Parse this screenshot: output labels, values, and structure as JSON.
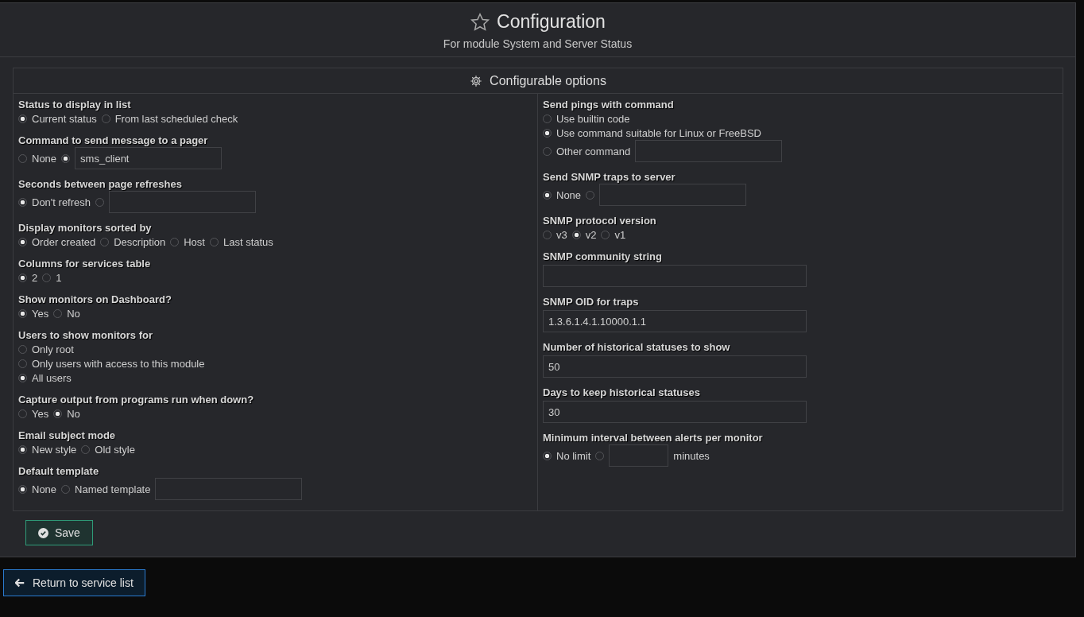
{
  "header": {
    "title": "Configuration",
    "subtitle": "For module System and Server Status"
  },
  "section": {
    "title": "Configurable options"
  },
  "columns": [
    {
      "options": [
        {
          "label": "Status to display in list",
          "kind": "radio_row",
          "choices": [
            {
              "kind": "radio",
              "label": "Current status",
              "selected": true
            },
            {
              "kind": "radio",
              "label": "From last scheduled check",
              "selected": false
            }
          ]
        },
        {
          "label": "Command to send message to a pager",
          "kind": "radio_row",
          "choices": [
            {
              "kind": "radio",
              "label": "None",
              "selected": false
            },
            {
              "kind": "radio",
              "selected": true
            },
            {
              "kind": "field",
              "value": "sms_client"
            }
          ]
        },
        {
          "label": "Seconds between page refreshes",
          "kind": "radio_row",
          "choices": [
            {
              "kind": "radio",
              "label": "Don't refresh",
              "selected": true
            },
            {
              "kind": "radio",
              "selected": false
            },
            {
              "kind": "field"
            }
          ]
        },
        {
          "label": "Display monitors sorted by",
          "kind": "radio_row",
          "choices": [
            {
              "kind": "radio",
              "label": "Order created",
              "selected": true
            },
            {
              "kind": "radio",
              "label": "Description",
              "selected": false
            },
            {
              "kind": "radio",
              "label": "Host",
              "selected": false
            },
            {
              "kind": "radio",
              "label": "Last status",
              "selected": false
            }
          ]
        },
        {
          "label": "Columns for services table",
          "kind": "radio_row",
          "choices": [
            {
              "kind": "radio",
              "label": "2",
              "selected": true
            },
            {
              "kind": "radio",
              "label": "1",
              "selected": false
            }
          ]
        },
        {
          "label": "Show monitors on Dashboard?",
          "kind": "radio_row",
          "choices": [
            {
              "kind": "radio",
              "label": "Yes",
              "selected": true
            },
            {
              "kind": "radio",
              "label": "No",
              "selected": false
            }
          ]
        },
        {
          "label": "Users to show monitors for",
          "kind": "radio_list",
          "choices": [
            {
              "kind": "radio",
              "label": "Only root",
              "selected": false
            },
            {
              "kind": "radio",
              "label": "Only users with access to this module",
              "selected": false
            },
            {
              "kind": "radio",
              "label": "All users",
              "selected": true
            }
          ]
        },
        {
          "label": "Capture output from programs run when down?",
          "kind": "radio_row",
          "choices": [
            {
              "kind": "radio",
              "label": "Yes",
              "selected": false
            },
            {
              "kind": "radio",
              "label": "No",
              "selected": true
            }
          ]
        },
        {
          "label": "Email subject mode",
          "kind": "radio_row",
          "choices": [
            {
              "kind": "radio",
              "label": "New style",
              "selected": true
            },
            {
              "kind": "radio",
              "label": "Old style",
              "selected": false
            }
          ]
        },
        {
          "label": "Default template",
          "kind": "radio_row",
          "choices": [
            {
              "kind": "radio",
              "label": "None",
              "selected": true
            },
            {
              "kind": "radio",
              "label": "Named template",
              "selected": false
            },
            {
              "kind": "field"
            }
          ]
        }
      ]
    },
    {
      "options": [
        {
          "label": "Send pings with command",
          "kind": "radio_list",
          "choices": [
            {
              "kind": "radio",
              "label": "Use builtin code",
              "selected": false
            },
            {
              "kind": "radio",
              "label": "Use command suitable for Linux or FreeBSD",
              "selected": true
            },
            {
              "kind": "radio_field",
              "label": "Other command",
              "selected": false
            }
          ]
        },
        {
          "label": "Send SNMP traps to server",
          "kind": "radio_row",
          "choices": [
            {
              "kind": "radio",
              "label": "None",
              "selected": true
            },
            {
              "kind": "radio",
              "selected": false
            },
            {
              "kind": "field"
            }
          ]
        },
        {
          "label": "SNMP protocol version",
          "kind": "radio_row",
          "choices": [
            {
              "kind": "radio",
              "label": "v3",
              "selected": false
            },
            {
              "kind": "radio",
              "label": "v2",
              "selected": true
            },
            {
              "kind": "radio",
              "label": "v1",
              "selected": false
            }
          ]
        },
        {
          "label": "SNMP community string",
          "kind": "text"
        },
        {
          "label": "SNMP OID for traps",
          "kind": "text",
          "value": "1.3.6.1.4.1.10000.1.1"
        },
        {
          "label": "Number of historical statuses to show",
          "kind": "text",
          "value": "50"
        },
        {
          "label": "Days to keep historical statuses",
          "kind": "text",
          "value": "30"
        },
        {
          "label": "Minimum interval between alerts per monitor",
          "kind": "radio_row",
          "choices": [
            {
              "kind": "radio",
              "label": "No limit",
              "selected": true
            },
            {
              "kind": "radio",
              "selected": false
            },
            {
              "kind": "short_field"
            },
            {
              "kind": "unit",
              "label": "minutes"
            }
          ]
        }
      ]
    }
  ],
  "save_button": {
    "label": "Save"
  },
  "return_button": {
    "label": "Return to service list"
  }
}
